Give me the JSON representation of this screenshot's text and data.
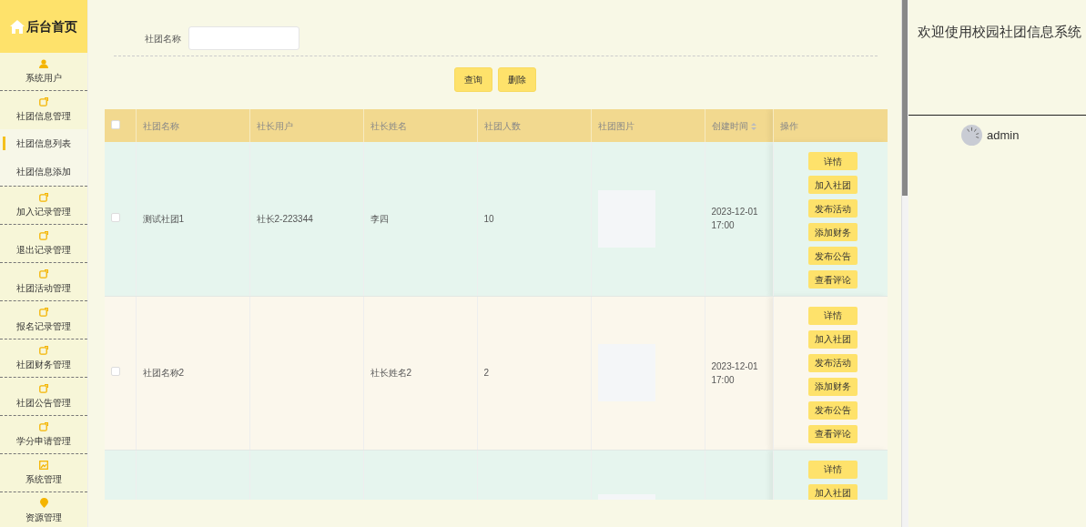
{
  "sidebar": {
    "title": "后台首页",
    "items": [
      {
        "label": "系统用户",
        "expanded": false
      },
      {
        "label": "社团信息管理",
        "expanded": true,
        "children": [
          {
            "label": "社团信息列表",
            "selected": true
          },
          {
            "label": "社团信息添加",
            "selected": false
          }
        ]
      },
      {
        "label": "加入记录管理",
        "expanded": false
      },
      {
        "label": "退出记录管理",
        "expanded": false
      },
      {
        "label": "社团活动管理",
        "expanded": false
      },
      {
        "label": "报名记录管理",
        "expanded": false
      },
      {
        "label": "社团财务管理",
        "expanded": false
      },
      {
        "label": "社团公告管理",
        "expanded": false
      },
      {
        "label": "学分申请管理",
        "expanded": false
      },
      {
        "label": "系统管理",
        "expanded": false
      },
      {
        "label": "资源管理",
        "expanded": false
      }
    ]
  },
  "search": {
    "label": "社团名称"
  },
  "buttons": [
    "查询",
    "删除"
  ],
  "table": {
    "checked": false,
    "columns": [
      "社团名称",
      "社长用户",
      "社长姓名",
      "社团人数",
      "社团图片",
      "创建时间",
      "操作"
    ],
    "rows": [
      {
        "checked": false,
        "cells": [
          "测试社团1",
          "社长2-223344",
          "李四",
          "10",
          "2023-12-01 17:00"
        ],
        "actions": [
          "详情",
          "加入社团",
          "发布活动",
          "添加财务",
          "发布公告",
          "查看评论"
        ]
      },
      {
        "checked": false,
        "cells": [
          "社团名称2",
          "",
          "社长姓名2",
          "2",
          "2023-12-01 17:00"
        ],
        "actions": [
          "详情",
          "加入社团",
          "发布活动",
          "添加财务",
          "发布公告",
          "查看评论"
        ]
      },
      {
        "cells": [
          "",
          "",
          "",
          "",
          ""
        ],
        "actions": [
          "详情",
          "加入社团"
        ]
      }
    ]
  },
  "welcome": "欢迎使用校园社团信息系统",
  "user": "admin"
}
